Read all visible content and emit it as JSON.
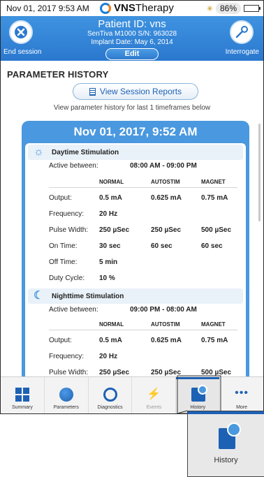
{
  "status_bar": {
    "datetime": "Nov 01, 2017  9:53 AM",
    "brand_bold": "VNS",
    "brand_rest": "Therapy",
    "battery": "86%"
  },
  "header": {
    "end_session": "End session",
    "interrogate": "Interrogate",
    "patient_id": "Patient ID: vns",
    "device": "SenTiva M1000 S/N: 963028",
    "implant_date": "Implant Date: May 6, 2014",
    "edit": "Edit"
  },
  "content": {
    "title": "PARAMETER HISTORY",
    "view_reports": "View Session Reports",
    "note": "View parameter history for last 1 timeframes below"
  },
  "card": {
    "title": "Nov 01, 2017, 9:52 AM",
    "columns": [
      "NORMAL",
      "AUTOSTIM",
      "MAGNET"
    ],
    "day": {
      "label": "Daytime Stimulation",
      "active_label": "Active between:",
      "active_value": "08:00 AM - 09:00 PM",
      "rows": [
        {
          "k": "Output:",
          "v": [
            "0.5 mA",
            "0.625 mA",
            "0.75 mA"
          ]
        },
        {
          "k": "Frequency:",
          "v": [
            "20 Hz",
            "",
            ""
          ]
        },
        {
          "k": "Pulse Width:",
          "v": [
            "250 µSec",
            "250 µSec",
            "500 µSec"
          ]
        },
        {
          "k": "On Time:",
          "v": [
            "30 sec",
            "60 sec",
            "60 sec"
          ]
        },
        {
          "k": "Off Time:",
          "v": [
            "5 min",
            "",
            ""
          ]
        },
        {
          "k": "Duty Cycle:",
          "v": [
            "10 %",
            "",
            ""
          ]
        }
      ]
    },
    "night": {
      "label": "Nighttime Stimulation",
      "active_label": "Active between:",
      "active_value": "09:00 PM - 08:00 AM",
      "rows": [
        {
          "k": "Output:",
          "v": [
            "0.5 mA",
            "0.625 mA",
            "0.75 mA"
          ]
        },
        {
          "k": "Frequency:",
          "v": [
            "20 Hz",
            "",
            ""
          ]
        },
        {
          "k": "Pulse Width:",
          "v": [
            "250 µSec",
            "250 µSec",
            "500 µSec"
          ]
        }
      ]
    }
  },
  "tabs": [
    "Summary",
    "Parameters",
    "Diagnostics",
    "Events",
    "History",
    "More"
  ],
  "zoom_label": "History",
  "colors": {
    "accent": "#1d61b5",
    "header": "#3f93e0",
    "card": "#4a98df"
  }
}
